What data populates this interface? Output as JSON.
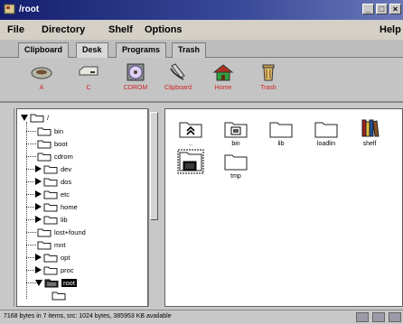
{
  "window": {
    "title": "/root",
    "buttons": [
      "_",
      "□",
      "×"
    ]
  },
  "menu": {
    "file": "File",
    "directory": "Directory",
    "shelf": "Shelf",
    "options": "Options",
    "help": "Help"
  },
  "tabs": [
    {
      "label": "Clipboard",
      "active": false
    },
    {
      "label": "Desk",
      "active": true
    },
    {
      "label": "Programs",
      "active": false
    },
    {
      "label": "Trash",
      "active": false
    }
  ],
  "shelf": [
    {
      "label": "A",
      "icon": "floppy-drive-icon"
    },
    {
      "label": "C",
      "icon": "hard-drive-icon"
    },
    {
      "label": "CDROM",
      "icon": "cdrom-icon"
    },
    {
      "label": "Clipboard",
      "icon": "clipboard-icon"
    },
    {
      "label": "Home",
      "icon": "home-icon"
    },
    {
      "label": "Trash",
      "icon": "trash-icon"
    }
  ],
  "tree": [
    {
      "label": "/",
      "expander": "down"
    },
    {
      "label": "bin",
      "expander": ""
    },
    {
      "label": "boot",
      "expander": ""
    },
    {
      "label": "cdrom",
      "expander": ""
    },
    {
      "label": "dev",
      "expander": "right"
    },
    {
      "label": "dos",
      "expander": "right"
    },
    {
      "label": "etc",
      "expander": "right"
    },
    {
      "label": "home",
      "expander": "right"
    },
    {
      "label": "lib",
      "expander": "right"
    },
    {
      "label": "lost+found",
      "expander": ""
    },
    {
      "label": "mnt",
      "expander": ""
    },
    {
      "label": "opt",
      "expander": "right"
    },
    {
      "label": "proc",
      "expander": "right"
    },
    {
      "label": "root",
      "expander": "down",
      "selected": true
    }
  ],
  "files": [
    {
      "label": "..",
      "icon": "parent-folder-icon"
    },
    {
      "label": "bin",
      "icon": "folder-icon"
    },
    {
      "label": "lib",
      "icon": "folder-icon"
    },
    {
      "label": "loadlin",
      "icon": "folder-icon"
    },
    {
      "label": "shelf",
      "icon": "books-icon"
    },
    {
      "label": "",
      "icon": "terminal-folder-icon"
    },
    {
      "label": "tmp",
      "icon": "folder-icon"
    }
  ],
  "status": {
    "text": "7168 bytes in 7 items, src: 1024 bytes, 385953 KB available"
  },
  "colors": {
    "title_bar": "#141e6e",
    "shelf_label": "#d02020",
    "selection": "#000000"
  }
}
